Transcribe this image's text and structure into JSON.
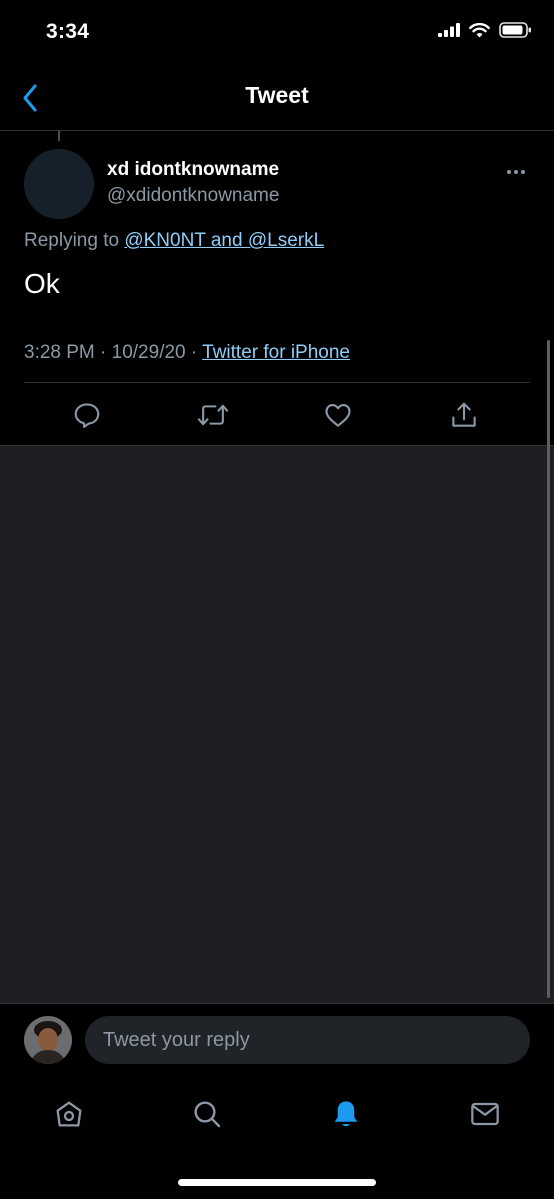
{
  "status_bar": {
    "time": "3:34"
  },
  "nav": {
    "title": "Tweet"
  },
  "tweet": {
    "display_name": "xd idontknowname",
    "handle": "@xdidontknowname",
    "replying_prefix": "Replying to",
    "replying_targets": "@KN0NT and @LserkL",
    "text": "Ok",
    "time_date": "3:28 PM · 10/29/20 ·",
    "source": "Twitter for iPhone"
  },
  "reply_bar": {
    "placeholder": "Tweet your reply"
  },
  "tabs": [
    "home-icon",
    "search-icon",
    "notifications-icon",
    "messages-icon"
  ],
  "colors": {
    "background": "#000000",
    "accent": "#1d9bf0",
    "link": "#8ecdf8",
    "muted": "#8b98a5",
    "divider": "#2f3336"
  }
}
